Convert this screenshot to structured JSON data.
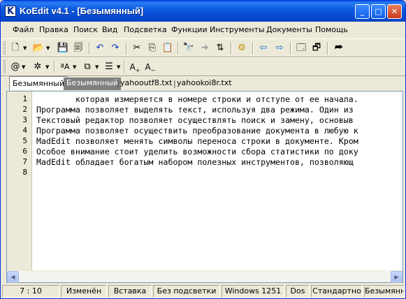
{
  "titlebar": {
    "app_icon_letter": "K",
    "title": "KoEdit v4.1 - [Безымянный]",
    "minimize": "_",
    "maximize": "□",
    "close": "✕"
  },
  "menu": [
    "Файл",
    "Правка",
    "Поиск",
    "Вид",
    "Подсветка",
    "Функции",
    "Инструменты",
    "Документы",
    "Помощь"
  ],
  "toolbar1_icons": [
    "new-file-icon",
    "open-folder-icon",
    "save-icon",
    "save-all-icon",
    "undo-icon",
    "redo-icon",
    "cut-icon",
    "copy-icon",
    "paste-icon",
    "find-icon",
    "find-next-icon",
    "replace-icon",
    "settings-icon",
    "prev-document-icon",
    "next-document-icon",
    "new-window-icon",
    "close-window-icon",
    "wordwrap-icon"
  ],
  "toolbar2_icons": [
    "at-sign-icon",
    "special-chars-icon",
    "text-case-icon",
    "insert-icon",
    "format-icon",
    "font-increase-icon",
    "font-decrease-icon"
  ],
  "tabs": [
    {
      "label": "Безымянный",
      "active": true
    },
    {
      "label": "Безымянный",
      "active": false
    },
    {
      "label": "yahooutf8.txt",
      "active": false
    },
    {
      "label": "yahookoi8r.txt",
      "active": false
    }
  ],
  "tab_separator": "|",
  "editor": {
    "line_numbers": [
      "1",
      "2",
      "3",
      "4",
      "5",
      "6",
      "7",
      "8"
    ],
    "lines": [
      "        которая измеряется в номере строки и отступе от ее начала.",
      "Программа позволяет выделять текст, используя два режима. Один из",
      "Текстовый редактор позволяет осуществлять поиск и замену, основыв",
      "Программа позволяет осуществить преобразование документа в любую к",
      "MadEdit позволяет менять символы переноса строки в документе. Кром",
      "Особое внимание стоит уделить возможности сбора статистики по доку",
      "MadEdit обладает богатым набором полезных инструментов, позволяющ",
      ""
    ]
  },
  "scrollbar": {
    "left_arrow": "◀",
    "right_arrow": "▶"
  },
  "statusbar": {
    "position": "7 : 10",
    "modified": "Изменён",
    "insert_mode": "Вставка",
    "highlight": "Без подсветки",
    "encoding": "Windows 1251",
    "line_endings": "Dos",
    "mode": "Стандартно",
    "filename": "Безымянный"
  }
}
